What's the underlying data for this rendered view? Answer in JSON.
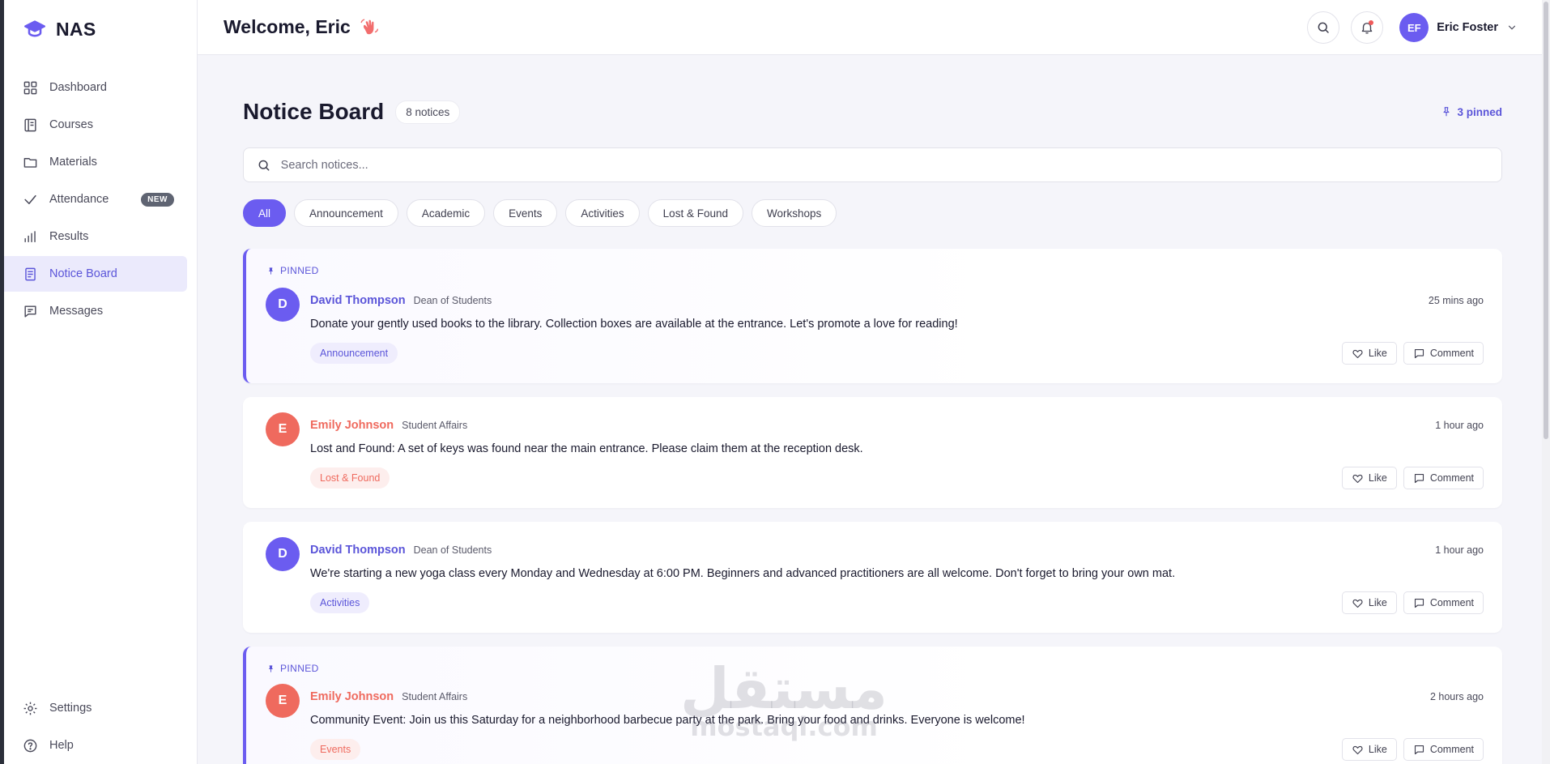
{
  "colors": {
    "accent": "#6b5cf0",
    "accent_text": "#5b55d9",
    "coral": "#ef6a5e",
    "new_badge": "#5f6472"
  },
  "brand": {
    "name": "NAS",
    "logo_icon": "graduation-cap-icon"
  },
  "sidebar": {
    "items": [
      {
        "label": "Dashboard",
        "icon": "grid-icon"
      },
      {
        "label": "Courses",
        "icon": "book-icon"
      },
      {
        "label": "Materials",
        "icon": "folder-icon"
      },
      {
        "label": "Attendance",
        "icon": "check-icon",
        "badge": "NEW"
      },
      {
        "label": "Results",
        "icon": "bar-chart-icon"
      },
      {
        "label": "Notice Board",
        "icon": "notice-icon",
        "active": true
      },
      {
        "label": "Messages",
        "icon": "message-icon"
      }
    ],
    "bottom": [
      {
        "label": "Settings",
        "icon": "gear-icon"
      },
      {
        "label": "Help",
        "icon": "help-icon"
      }
    ]
  },
  "header": {
    "welcome": "Welcome, Eric",
    "user": {
      "initials": "EF",
      "name": "Eric Foster"
    }
  },
  "main": {
    "title": "Notice Board",
    "count": "8 notices",
    "pinned": "3 pinned",
    "search": {
      "placeholder": "Search notices...",
      "value": ""
    },
    "filters": [
      "All",
      "Announcement",
      "Academic",
      "Events",
      "Activities",
      "Lost & Found",
      "Workshops"
    ],
    "active_filter": "All"
  },
  "notices": [
    {
      "pinned": true,
      "pin_label": "PINNED",
      "initial": "D",
      "author": "David Thompson",
      "role": "Dean of Students",
      "time": "25 mins ago",
      "message": "Donate your gently used books to the library. Collection boxes are available at the entrance. Let's promote a love for reading!",
      "tag": "Announcement",
      "color": "#6b5cf0",
      "tag_bg": "#efedfd"
    },
    {
      "pinned": false,
      "initial": "E",
      "author": "Emily Johnson",
      "role": "Student Affairs",
      "time": "1 hour ago",
      "message": "Lost and Found: A set of keys was found near the main entrance. Please claim them at the reception desk.",
      "tag": "Lost & Found",
      "color": "#ef6a5e",
      "tag_bg": "#fdeeed"
    },
    {
      "pinned": false,
      "initial": "D",
      "author": "David Thompson",
      "role": "Dean of Students",
      "time": "1 hour ago",
      "message": "We're starting a new yoga class every Monday and Wednesday at 6:00 PM. Beginners and advanced practitioners are all welcome. Don't forget to bring your own mat.",
      "tag": "Activities",
      "color": "#6b5cf0",
      "tag_bg": "#efedfd"
    },
    {
      "pinned": true,
      "pin_label": "PINNED",
      "initial": "E",
      "author": "Emily Johnson",
      "role": "Student Affairs",
      "time": "2 hours ago",
      "message": "Community Event: Join us this Saturday for a neighborhood barbecue party at the park. Bring your food and drinks. Everyone is welcome!",
      "tag": "Events",
      "color": "#ef6a5e",
      "tag_bg": "#fdeeed"
    }
  ],
  "actions": {
    "like": "Like",
    "comment": "Comment"
  },
  "watermark": {
    "line1": "مستقل",
    "line2": "mostaql.com"
  }
}
